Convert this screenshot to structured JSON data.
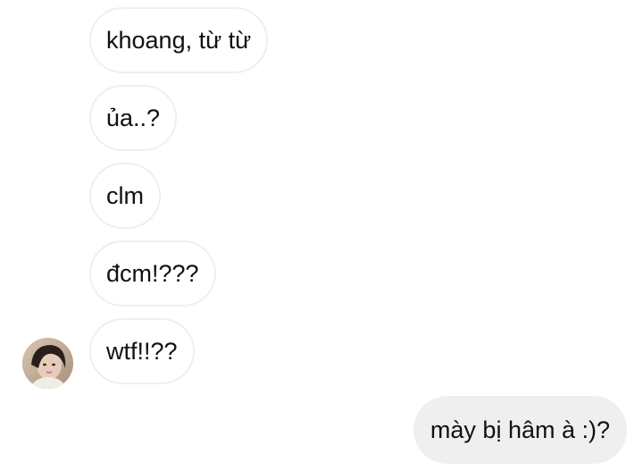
{
  "conversation": {
    "incoming": [
      {
        "text": "khoang, từ từ"
      },
      {
        "text": "ủa..?"
      },
      {
        "text": "clm"
      },
      {
        "text": "đcm!???"
      },
      {
        "text": "wtf!!??"
      }
    ],
    "outgoing": [
      {
        "text": "mày bị hâm à :)?"
      }
    ],
    "avatar_icon": "user-avatar-photo"
  },
  "colors": {
    "background": "#ffffff",
    "incoming_border": "#efefef",
    "outgoing_bg": "#efefef",
    "text": "#111111"
  }
}
